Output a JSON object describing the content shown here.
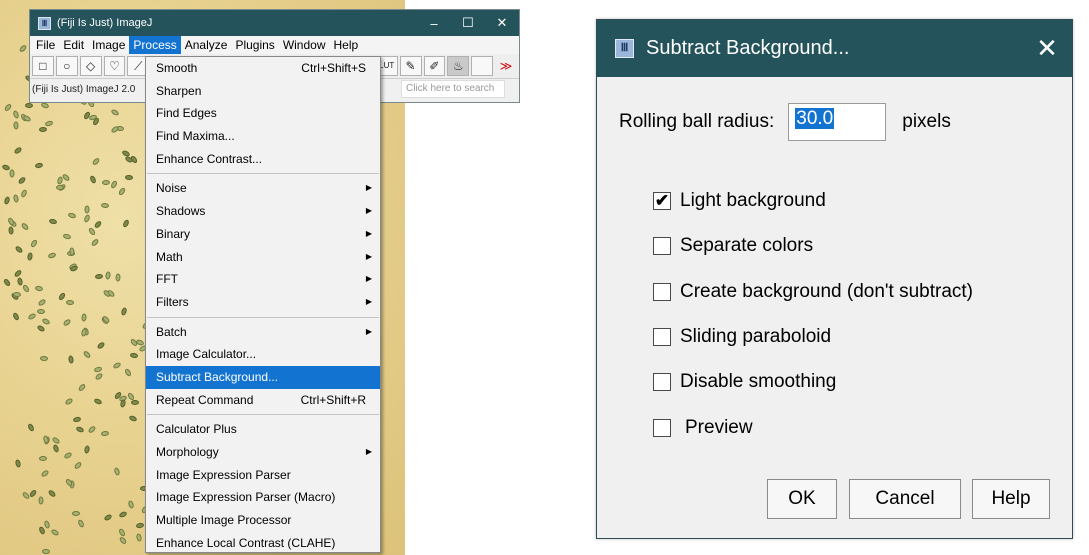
{
  "imagej": {
    "window_title": "(Fiji Is Just) ImageJ",
    "app_icon": "fiji-icon",
    "window_buttons": [
      "–",
      "☐",
      "✕"
    ],
    "menubar": [
      "File",
      "Edit",
      "Image",
      "Process",
      "Analyze",
      "Plugins",
      "Window",
      "Help"
    ],
    "active_menu": "Process",
    "status_text": "(Fiji Is Just) ImageJ 2.0",
    "search_placeholder": "Click here to search",
    "tool_lut_label": "LUT",
    "tool_more": "≫"
  },
  "process_menu": {
    "items": [
      {
        "label": "Smooth",
        "shortcut": "Ctrl+Shift+S",
        "submenu": false
      },
      {
        "label": "Sharpen",
        "shortcut": "",
        "submenu": false
      },
      {
        "label": "Find Edges",
        "shortcut": "",
        "submenu": false
      },
      {
        "label": "Find Maxima...",
        "shortcut": "",
        "submenu": false
      },
      {
        "label": "Enhance Contrast...",
        "shortcut": "",
        "submenu": false
      },
      {
        "label": "Noise",
        "shortcut": "",
        "submenu": true
      },
      {
        "label": "Shadows",
        "shortcut": "",
        "submenu": true
      },
      {
        "label": "Binary",
        "shortcut": "",
        "submenu": true
      },
      {
        "label": "Math",
        "shortcut": "",
        "submenu": true
      },
      {
        "label": "FFT",
        "shortcut": "",
        "submenu": true
      },
      {
        "label": "Filters",
        "shortcut": "",
        "submenu": true
      },
      {
        "label": "Batch",
        "shortcut": "",
        "submenu": true
      },
      {
        "label": "Image Calculator...",
        "shortcut": "",
        "submenu": false
      },
      {
        "label": "Subtract Background...",
        "shortcut": "",
        "submenu": false,
        "selected": true
      },
      {
        "label": "Repeat Command",
        "shortcut": "Ctrl+Shift+R",
        "submenu": false
      },
      {
        "label": "Calculator Plus",
        "shortcut": "",
        "submenu": false
      },
      {
        "label": "Morphology",
        "shortcut": "",
        "submenu": true
      },
      {
        "label": "Image Expression Parser",
        "shortcut": "",
        "submenu": false
      },
      {
        "label": "Image Expression Parser (Macro)",
        "shortcut": "",
        "submenu": false
      },
      {
        "label": "Multiple Image Processor",
        "shortcut": "",
        "submenu": false
      },
      {
        "label": "Enhance Local Contrast (CLAHE)",
        "shortcut": "",
        "submenu": false
      }
    ]
  },
  "dialog": {
    "title": "Subtract Background...",
    "close_glyph": "✕",
    "radius_label": "Rolling ball radius:",
    "radius_value": "30.0",
    "radius_unit": "pixels",
    "checkboxes": [
      {
        "label": "Light background",
        "checked": true
      },
      {
        "label": "Separate colors",
        "checked": false
      },
      {
        "label": "Create background (don't subtract)",
        "checked": false
      },
      {
        "label": "Sliding paraboloid",
        "checked": false
      },
      {
        "label": "Disable smoothing",
        "checked": false
      },
      {
        "label": "Preview",
        "checked": false
      }
    ],
    "buttons": {
      "ok": "OK",
      "cancel": "Cancel",
      "help": "Help"
    }
  },
  "colors": {
    "titlebar": "#24535b",
    "selection": "#1373d1",
    "background_image": "#e8d290"
  }
}
